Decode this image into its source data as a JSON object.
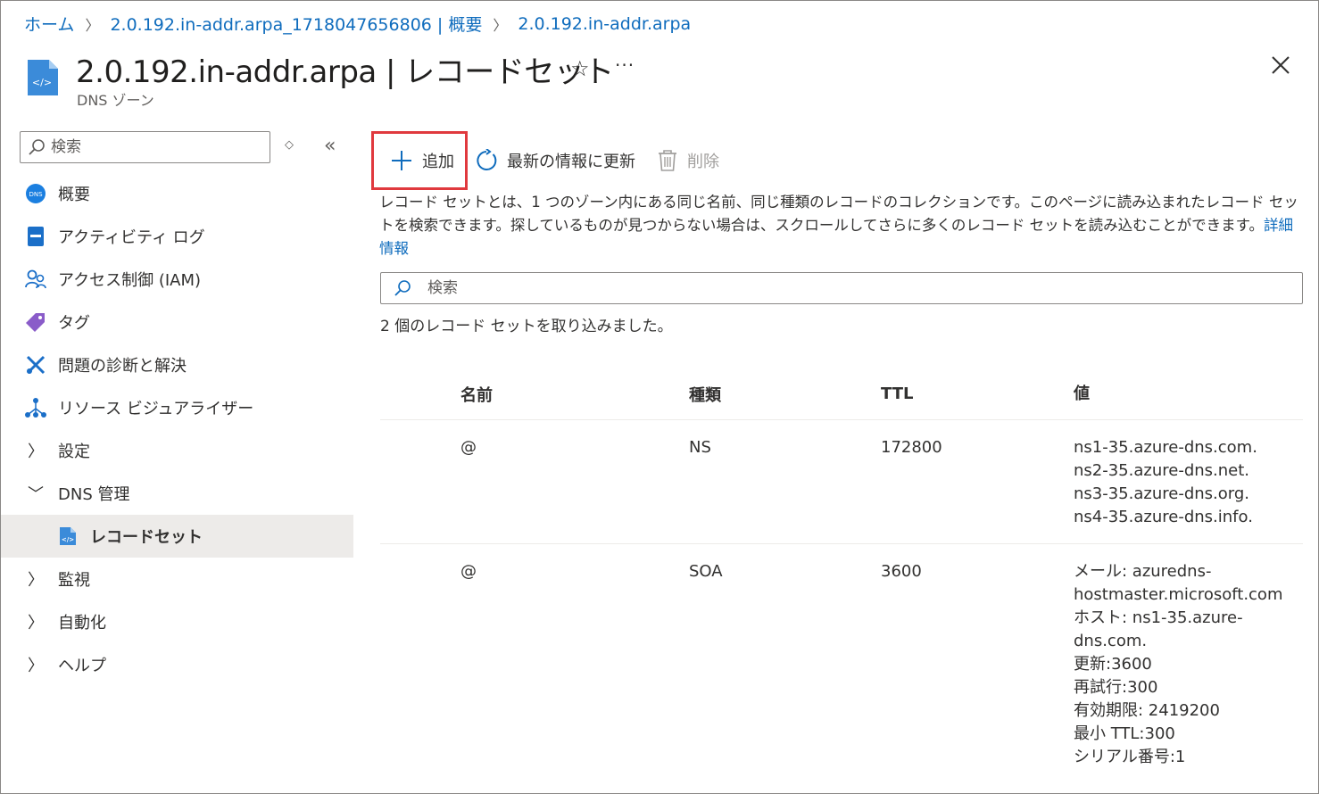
{
  "breadcrumb": {
    "home": "ホーム",
    "item2": "2.0.192.in-addr.arpa_1718047656806 | 概要",
    "item3": "2.0.192.in-addr.arpa"
  },
  "header": {
    "title": "2.0.192.in-addr.arpa | レコードセット",
    "subtitle": "DNS ゾーン"
  },
  "sidebar": {
    "search_placeholder": "検索",
    "items": [
      {
        "label": "概要",
        "icon": "dns-zone-icon"
      },
      {
        "label": "アクティビティ ログ",
        "icon": "activity-log-icon"
      },
      {
        "label": "アクセス制御 (IAM)",
        "icon": "people-icon"
      },
      {
        "label": "タグ",
        "icon": "tag-icon"
      },
      {
        "label": "問題の診断と解決",
        "icon": "wrench-icon"
      },
      {
        "label": "リソース ビジュアライザー",
        "icon": "hierarchy-icon"
      },
      {
        "label": "設定",
        "icon": "chevron-right-icon"
      },
      {
        "label": "DNS 管理",
        "icon": "chevron-down-icon"
      },
      {
        "label": "レコードセット",
        "icon": "record-set-icon"
      },
      {
        "label": "監視",
        "icon": "chevron-right-icon"
      },
      {
        "label": "自動化",
        "icon": "chevron-right-icon"
      },
      {
        "label": "ヘルプ",
        "icon": "chevron-right-icon"
      }
    ]
  },
  "toolbar": {
    "add": "追加",
    "refresh": "最新の情報に更新",
    "delete": "削除"
  },
  "description": {
    "text": "レコード セットとは、1 つのゾーン内にある同じ名前、同じ種類のレコードのコレクションです。このページに読み込まれたレコード セットを検索できます。探しているものが見つからない場合は、スクロールしてさらに多くのレコード セットを読み込むことができます。",
    "link": "詳細情報"
  },
  "main": {
    "search_placeholder": "検索",
    "status": "2 個のレコード セットを取り込みました。"
  },
  "table": {
    "headers": [
      "名前",
      "種類",
      "TTL",
      "値"
    ],
    "rows": [
      {
        "name": "@",
        "type": "NS",
        "ttl": "172800",
        "values": [
          "ns1-35.azure-dns.com.",
          "ns2-35.azure-dns.net.",
          "ns3-35.azure-dns.org.",
          "ns4-35.azure-dns.info."
        ]
      },
      {
        "name": "@",
        "type": "SOA",
        "ttl": "3600",
        "values": [
          "メール: azuredns-",
          "hostmaster.microsoft.com",
          "ホスト: ns1-35.azure-",
          "dns.com.",
          "更新:3600",
          "再試行:300",
          "有効期限: 2419200",
          "最小 TTL:300",
          "シリアル番号:1"
        ]
      }
    ]
  },
  "colors": {
    "link": "#0f6cbd",
    "highlight_border": "#e0393e",
    "selected_bg": "#edebe9"
  }
}
